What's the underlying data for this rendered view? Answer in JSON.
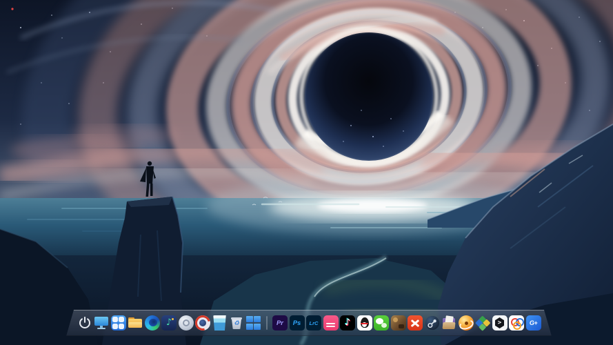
{
  "desktop": {
    "wallpaper": {
      "scene": "interstellar-black-hole-painting",
      "colors": {
        "sky_navy": "#101a30",
        "swirl_pink": "#e2aba2",
        "swirl_white": "#f2ede9",
        "swirl_slate": "#7c8bab",
        "hole_core": "#070b14",
        "water_teal": "#2a5a78",
        "mountain_blue": "#16273f"
      }
    }
  },
  "dock": {
    "system_items": [
      {
        "id": "power",
        "icon": "power-icon"
      },
      {
        "id": "show-desktop",
        "icon": "monitor-icon"
      },
      {
        "id": "launcher",
        "icon": "app-grid-icon"
      },
      {
        "id": "file-manager",
        "icon": "folder-icon"
      },
      {
        "id": "browser",
        "icon": "browser-swirl-icon"
      },
      {
        "id": "music-app",
        "icon": "music-note-icon"
      },
      {
        "id": "camera-app",
        "icon": "lens-icon"
      },
      {
        "id": "clock-app",
        "icon": "red-ring-clock-icon"
      },
      {
        "id": "recorder-app",
        "icon": "blue-glass-icon"
      },
      {
        "id": "trash",
        "icon": "recycle-bin-icon"
      },
      {
        "id": "window-panes-app",
        "icon": "blue-panes-icon"
      }
    ],
    "app_items": [
      {
        "id": "adobe-premiere",
        "glyph": "Pr",
        "bg": "#1e0b45",
        "fg": "#9d9af8"
      },
      {
        "id": "adobe-photoshop",
        "glyph": "Ps",
        "bg": "#001d33",
        "fg": "#2fa3f7"
      },
      {
        "id": "adobe-lightroom-classic",
        "glyph": "LrC",
        "bg": "#001d33",
        "fg": "#2fa3f7"
      },
      {
        "id": "pink-video-app",
        "bg": "#f2477e"
      },
      {
        "id": "douyin",
        "bg": "#000000"
      },
      {
        "id": "qq",
        "bg": "#ffffff"
      },
      {
        "id": "wechat",
        "bg": "#4fc32e"
      },
      {
        "id": "brown-game-app",
        "bg": "#7a5a32"
      },
      {
        "id": "red-cross-app",
        "bg": "#e4472a"
      },
      {
        "id": "steam",
        "bg": "#1b2838"
      },
      {
        "id": "documents-folder-app",
        "bg": "#8f76c2"
      },
      {
        "id": "orange-sphere-player",
        "bg": "#f29a2e"
      },
      {
        "id": "diamond-mosaic-app",
        "bg": "#3aa14a"
      },
      {
        "id": "hexagon-prompt-app",
        "bg": "#15171c"
      },
      {
        "id": "tri-ring-app",
        "bg": "#ffffff"
      },
      {
        "id": "gamepp",
        "glyph": "G+",
        "bg": "#2b6de0"
      }
    ]
  }
}
